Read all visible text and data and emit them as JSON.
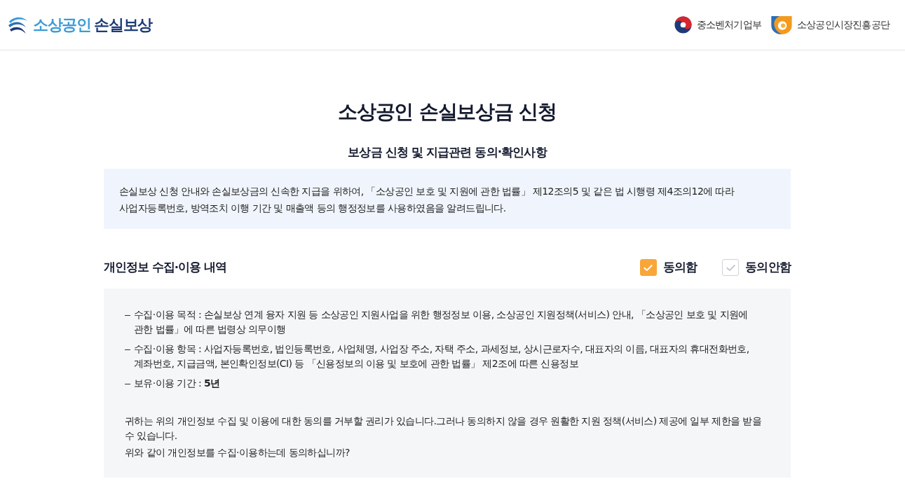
{
  "header": {
    "logo": {
      "words": [
        "소상공인",
        "손실보상"
      ]
    },
    "partners": [
      {
        "name": "중소벤처기업부",
        "kind": "ministry"
      },
      {
        "name": "소상공인시장진흥공단",
        "kind": "agency"
      }
    ]
  },
  "page": {
    "title": "소상공인 손실보상금 신청",
    "subtitle": "보상금 신청 및 지급관련 동의·확인사항"
  },
  "notice": "손실보상 신청 안내와 손실보상금의 신속한 지급을 위하여, 「소상공인 보호 및 지원에 관한 법률」 제12조의5 및 같은 법 시행령 제4조의12에 따라\n사업자등록번호, 방역조치 이행 기간 및 매출액 등의 행정정보를 사용하였음을 알려드립니다.",
  "section": {
    "title": "개인정보 수집·이용 내역",
    "options": [
      {
        "label": "동의함",
        "selected": true
      },
      {
        "label": "동의안함",
        "selected": false
      }
    ],
    "items": [
      "수집·이용 목적 : 손실보상 연계 융자 지원 등 소상공인 지원사업을 위한 행정정보 이용, 소상공인 지원정책(서비스) 안내, 「소상공인 보호 및 지원에 관한 법률」에 따른 법령상 의무이행",
      "수집·이용 항목 : 사업자등록번호, 법인등록번호, 사업체명, 사업장 주소, 자택 주소, 과세정보, 상시근로자수, 대표자의 이름, 대표자의 휴대전화번호, 계좌번호, 지급금액, 본인확인정보(CI) 등 「신용정보의 이용 및 보호에 관한 법률」 제2조에 따른 신용정보",
      "보유·이용 기간 : **5년**"
    ],
    "statement": "귀하는 위의 개인정보 수집 및 이용에 대한 동의를 거부할 권리가 있습니다.그러나 동의하지 않을 경우 원활한 지원 정책(서비스) 제공에 일부 제한을 받을 수 있습니다.",
    "question": "위와 같이 개인정보를 수집·이용하는데 동의하십니까?"
  }
}
